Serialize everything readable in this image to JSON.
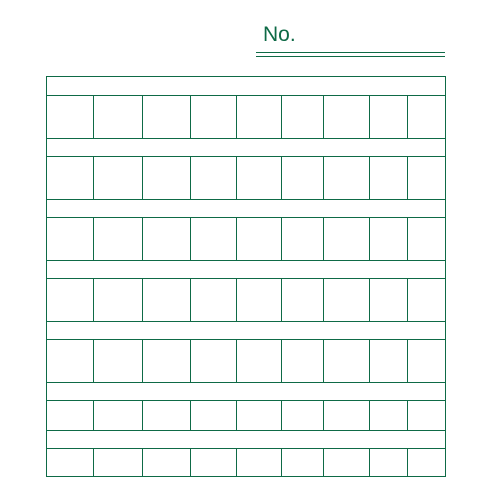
{
  "header": {
    "number_label": "No."
  },
  "grid": {
    "column_count": 9,
    "row_count": 7
  },
  "colors": {
    "ink": "#0e6a46",
    "background": "#ffffff"
  }
}
